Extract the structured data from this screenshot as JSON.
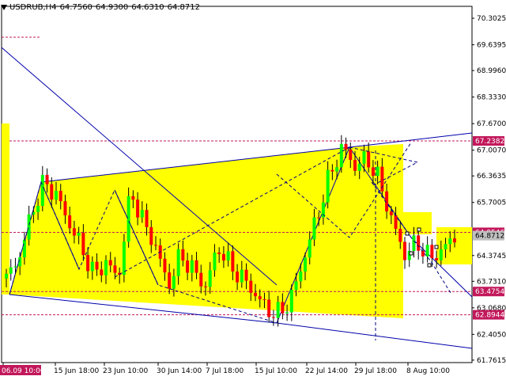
{
  "header": {
    "symbol": "USDRUB,H4",
    "open": "64.7560",
    "high": "64.9300",
    "low": "64.6310",
    "close": "64.8712"
  },
  "colors": {
    "background": "#ffffff",
    "highlight": "#ffff00",
    "bull_candle": "#00ff00",
    "bear_candle": "#ff0000",
    "level_line": "#c2185b",
    "trend_line": "#0000aa",
    "wave_line": "#000080"
  },
  "chart_data": {
    "type": "candlestick",
    "ylim": [
      61.7,
      70.6
    ],
    "y_ticks": [
      "70.3025",
      "69.6395",
      "68.9960",
      "68.3330",
      "67.6700",
      "67.0070",
      "66.3635",
      "65.7005",
      "64.3745",
      "63.7310",
      "63.0680",
      "62.4050",
      "61.7615"
    ],
    "x_ticks": [
      "06.09 10:00",
      "15 Jun 18:00",
      "23 Jun 10:00",
      "30 Jun 14:00",
      "7 Jul 18:00",
      "15 Jul 10:00",
      "22 Jul 14:00",
      "29 Jul 18:00",
      "8 Aug 10:00"
    ],
    "price_levels": [
      "67.2382",
      "64.9546",
      "64.8712",
      "63.4754",
      "62.8944"
    ],
    "close_path": [
      63.8,
      64.3,
      65.4,
      66.2,
      65.9,
      65.2,
      64.6,
      63.9,
      64.2,
      63.8,
      66.0,
      65.2,
      64.6,
      63.6,
      64.4,
      64.0,
      63.6,
      64.6,
      64.1,
      63.8,
      63.4,
      63.0,
      62.9,
      63.4,
      64.4,
      65.4,
      66.4,
      67.1,
      66.6,
      66.8,
      66.2,
      65.2,
      64.4,
      64.7,
      64.3,
      64.5,
      64.87
    ]
  }
}
